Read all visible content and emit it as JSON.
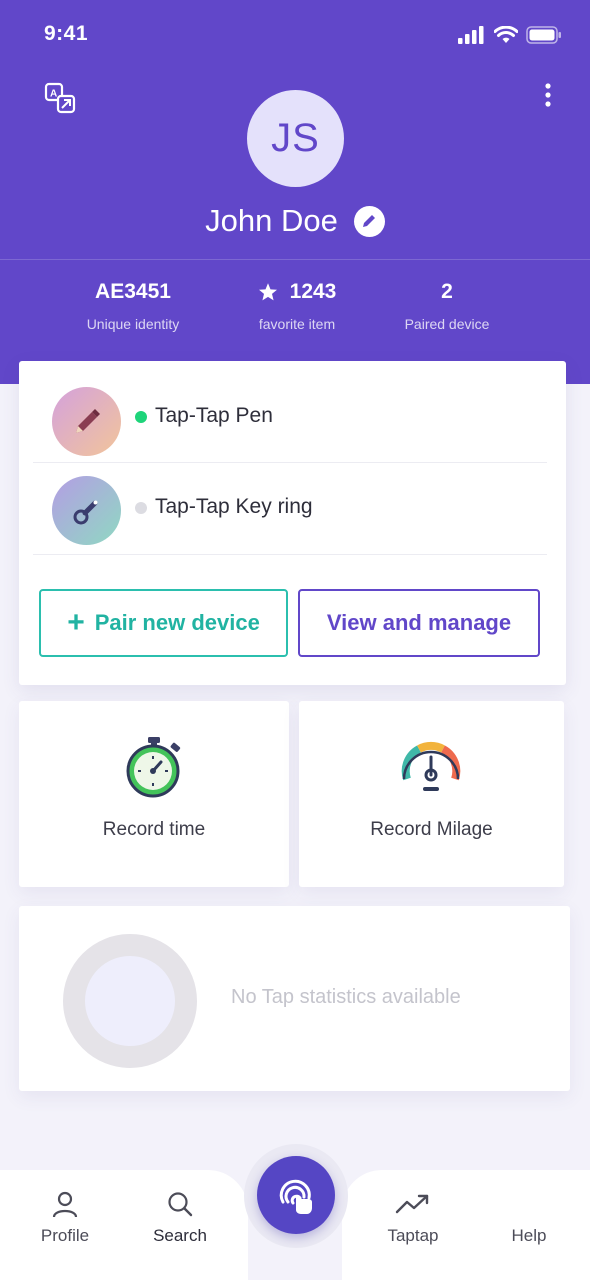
{
  "status_bar": {
    "time": "9:41"
  },
  "profile": {
    "initials": "JS",
    "name": "John Doe"
  },
  "stats": [
    {
      "value": "AE3451",
      "label": "Unique identity"
    },
    {
      "value": "1243",
      "label": "favorite item",
      "icon": "star-icon"
    },
    {
      "value": "2",
      "label": "Paired device"
    }
  ],
  "devices": [
    {
      "name": "Tap-Tap Pen",
      "status": "online",
      "status_color": "#1ed47a",
      "icon": "pen-icon"
    },
    {
      "name": "Tap-Tap Key ring",
      "status": "offline",
      "status_color": "#dcdce2",
      "icon": "key-ring-icon"
    }
  ],
  "buttons": {
    "pair": "Pair new device",
    "pair_icon": "+",
    "manage": "View and manage"
  },
  "tiles": {
    "record_time": "Record time",
    "record_milage": "Record Milage"
  },
  "statistics": {
    "empty_text": "No Tap statistics available"
  },
  "nav": {
    "profile": "Profile",
    "search": "Search",
    "taptap": "Taptap",
    "help": "Help"
  },
  "colors": {
    "primary": "#6147c9",
    "teal": "#21b3a2"
  }
}
